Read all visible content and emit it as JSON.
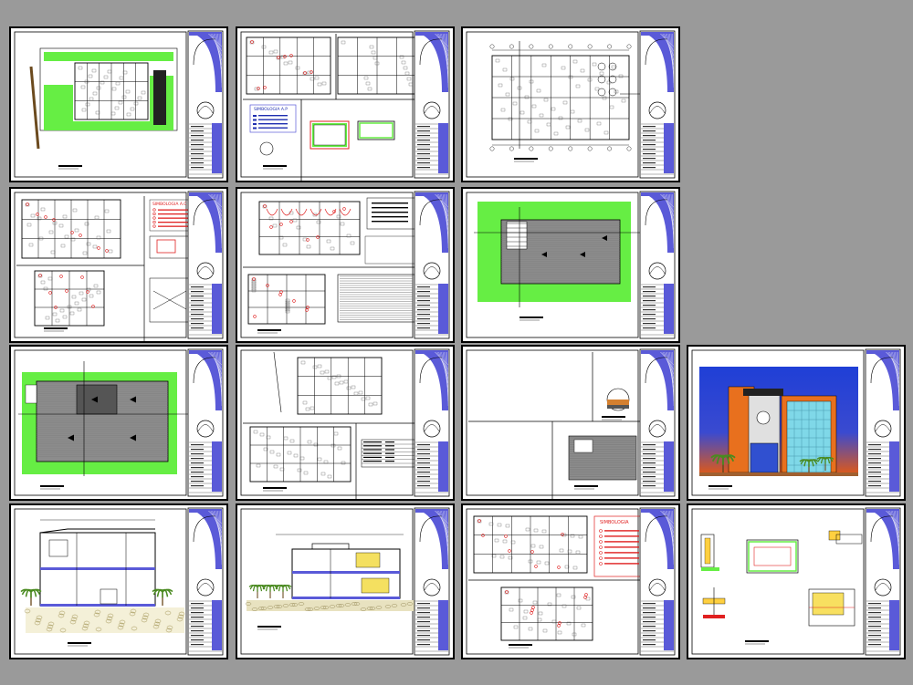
{
  "drawing_set": {
    "rows": 4,
    "cols": 4,
    "sheets": [
      {
        "id": "s1",
        "kind": "plan-site"
      },
      {
        "id": "s2",
        "kind": "installations-water"
      },
      {
        "id": "s3",
        "kind": "plan-furniture"
      },
      {
        "id": "s4",
        "kind": "installations-electric"
      },
      {
        "id": "s5",
        "kind": "installations-sanitary"
      },
      {
        "id": "s6",
        "kind": "roof-plan"
      },
      {
        "id": "s7",
        "kind": "roof-plan-2"
      },
      {
        "id": "s8",
        "kind": "plan-schedule"
      },
      {
        "id": "s9",
        "kind": "detail-sheet"
      },
      {
        "id": "s10",
        "kind": "facade-render"
      },
      {
        "id": "s11",
        "kind": "section-a"
      },
      {
        "id": "s12",
        "kind": "section-b"
      },
      {
        "id": "s13",
        "kind": "plan-lighting"
      },
      {
        "id": "s14",
        "kind": "construction-details"
      }
    ]
  },
  "legend_texts": {
    "water": "SIMBOLOGIA A.P",
    "electric": "SIMBOLOGIA A.C",
    "lighting": "SIMBOLOGIA"
  },
  "colors": {
    "background": "#9a9a9a",
    "paper": "#ffffff",
    "title_block_blue": "#5a5ad8",
    "landscape_green": "#66ee44",
    "roof_gray": "#8c8c8c",
    "sky_blue": "#1f3fd6",
    "sky_orange": "#e65a10",
    "facade_orange": "#e8701e",
    "glass_cyan": "#7fd8e8",
    "red_lines": "#e02020"
  }
}
